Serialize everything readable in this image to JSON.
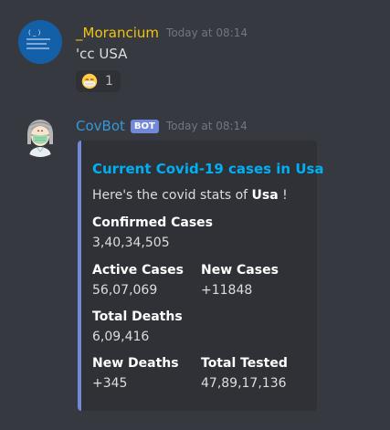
{
  "messages": [
    {
      "username": "_Morancium",
      "timestamp": "Today at 08:14",
      "text": "'cc USA",
      "reaction": {
        "emoji": "mask-face",
        "count": "1"
      },
      "avatar_text": "( _ )"
    },
    {
      "username": "CovBot",
      "bot_tag": "BOT",
      "timestamp": "Today at 08:14",
      "embed": {
        "title": "Current Covid-19 cases in Usa",
        "description_prefix": "Here's the covid stats of ",
        "description_country": "Usa",
        "description_suffix": " !",
        "fields": {
          "confirmed_name": "Confirmed Cases",
          "confirmed_value": "3,40,34,505",
          "active_name": "Active Cases",
          "active_value": "56,07,069",
          "new_cases_name": "New Cases",
          "new_cases_value": "+11848",
          "deaths_name": "Total Deaths",
          "deaths_value": "6,09,416",
          "new_deaths_name": "New Deaths",
          "new_deaths_value": "+345",
          "tested_name": "Total Tested",
          "tested_value": "47,89,17,136"
        },
        "accent_color": "#7289da"
      }
    }
  ],
  "colors": {
    "background": "#36393f",
    "embed_bg": "#2f3136",
    "username_1": "#f1c40f",
    "username_2": "#3498db",
    "embed_title": "#00b0f4"
  }
}
